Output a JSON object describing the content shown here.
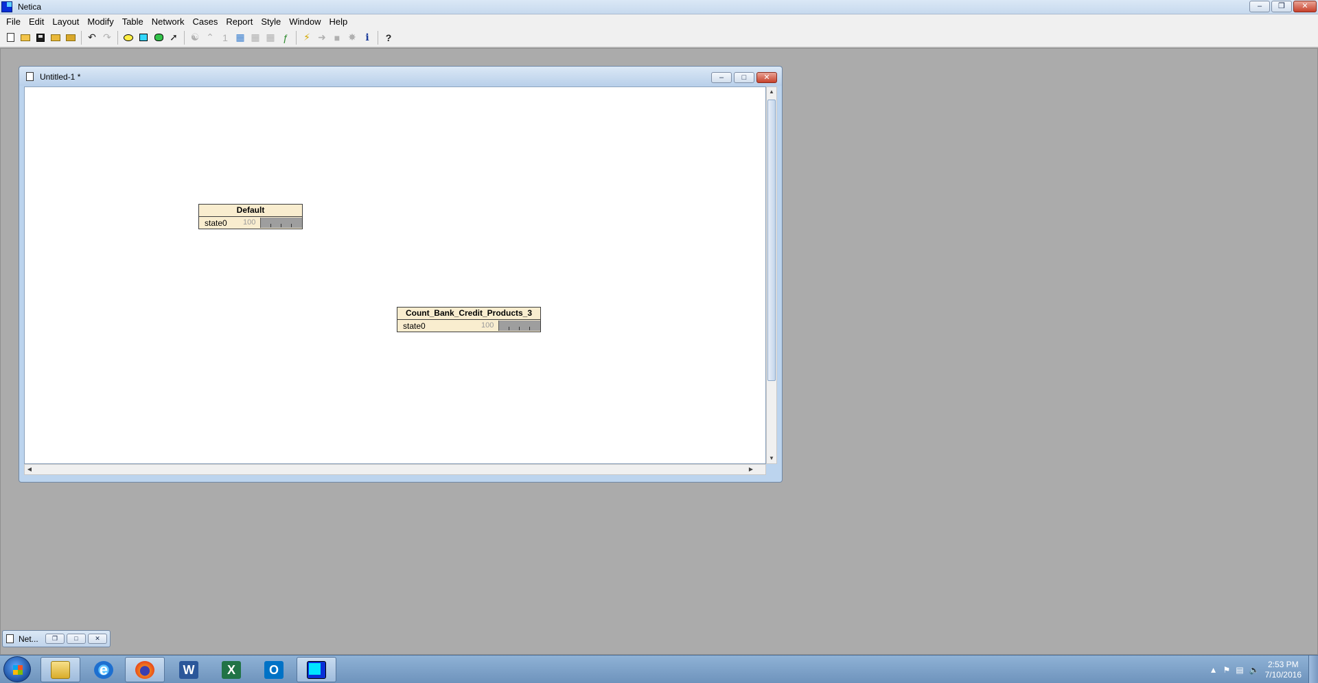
{
  "window": {
    "title": "Netica",
    "controls": [
      "minimize",
      "restore",
      "close"
    ]
  },
  "menu": [
    "File",
    "Edit",
    "Layout",
    "Modify",
    "Table",
    "Network",
    "Cases",
    "Report",
    "Style",
    "Window",
    "Help"
  ],
  "child_window": {
    "title": "Untitled-1 *",
    "nodes": [
      {
        "name": "Default",
        "state": "state0",
        "value": "100"
      },
      {
        "name": "Count_Bank_Credit_Products_3",
        "state": "state0",
        "value": "100"
      }
    ]
  },
  "minimized_window": {
    "title": "Net..."
  },
  "taskbar": {
    "apps": [
      "start-button",
      "file-explorer",
      "internet-explorer",
      "firefox",
      "word",
      "excel",
      "outlook",
      "netica"
    ],
    "time": "2:53 PM",
    "date": "7/10/2016"
  },
  "colors": {
    "node_fill": "#f9edcf",
    "workspace": "#ababab",
    "title_gradient": "#c6d9ee"
  }
}
